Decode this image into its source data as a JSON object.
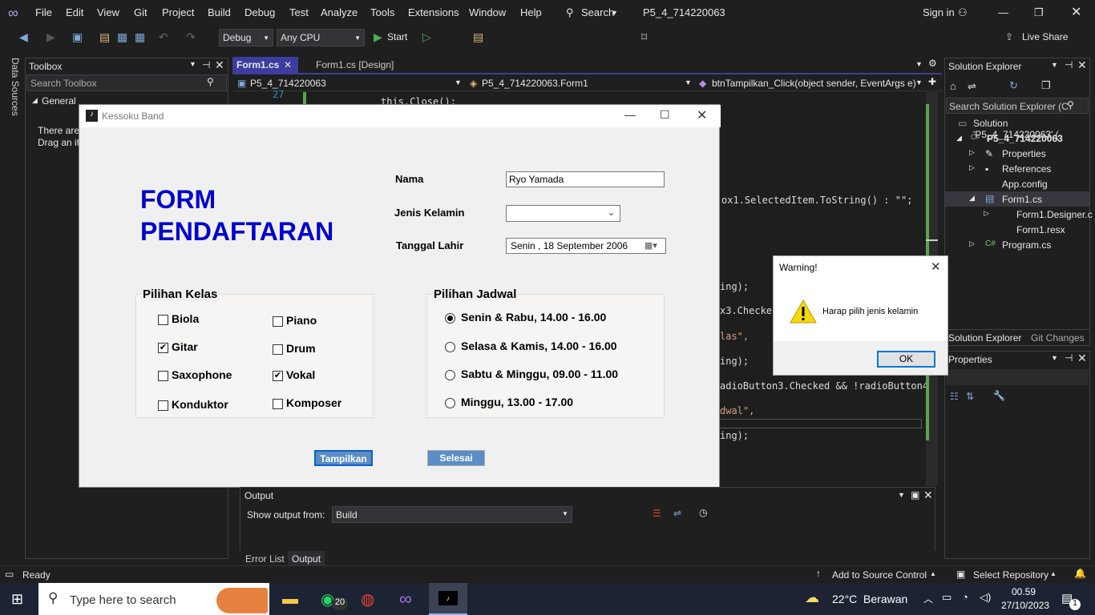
{
  "menubar": {
    "items": [
      "File",
      "Edit",
      "View",
      "Git",
      "Project",
      "Build",
      "Debug",
      "Test",
      "Analyze",
      "Tools",
      "Extensions",
      "Window",
      "Help"
    ],
    "search": "Search",
    "solution_name": "P5_4_714220063",
    "sign_in": "Sign in"
  },
  "toolbar": {
    "config": "Debug",
    "platform": "Any CPU",
    "start": "Start",
    "live_share": "Live Share"
  },
  "toolbox": {
    "title": "Toolbox",
    "search_placeholder": "Search Toolbox",
    "group": "General",
    "empty_text_1": "There are",
    "empty_text_2": "Drag an it"
  },
  "left_rail": {
    "data_sources": "Data Sources"
  },
  "tabs": {
    "tab1": "Form1.cs",
    "tab2": "Form1.cs [Design]"
  },
  "navbar": {
    "project": "P5_4_714220063",
    "class": "P5_4_714220063.Form1",
    "member": "btnTampilkan_Click(object sender, EventArgs e)"
  },
  "code": {
    "line_no": "27",
    "line_top": "this.Close();",
    "l1": "ox1.SelectedItem.ToString() : \"\";",
    "l2": "ing);",
    "l3": "x3.Checke",
    "l4": "las\",",
    "l5": "ing);",
    "l6": "adioButton3.Checked && !radioButton4.",
    "l7": "dwal\",",
    "l8": "ing);"
  },
  "form": {
    "window_title": "Kessoku Band",
    "heading_line1": "FORM",
    "heading_line2": "PENDAFTARAN",
    "label_nama": "Nama",
    "nama_value": "Ryo Yamada",
    "label_jk": "Jenis Kelamin",
    "jk_value": "",
    "label_tgl": "Tanggal Lahir",
    "tgl_value": "Senin , 18 September 2006",
    "group_kelas": "Pilihan Kelas",
    "kelas": [
      {
        "label": "Biola",
        "checked": false
      },
      {
        "label": "Piano",
        "checked": false
      },
      {
        "label": "Gitar",
        "checked": true
      },
      {
        "label": "Drum",
        "checked": false
      },
      {
        "label": "Saxophone",
        "checked": false
      },
      {
        "label": "Vokal",
        "checked": true
      },
      {
        "label": "Konduktor",
        "checked": false
      },
      {
        "label": "Komposer",
        "checked": false
      }
    ],
    "group_jadwal": "Pilihan Jadwal",
    "jadwal": [
      {
        "label": "Senin & Rabu, 14.00 - 16.00",
        "selected": true
      },
      {
        "label": "Selasa & Kamis, 14.00 - 16.00",
        "selected": false
      },
      {
        "label": "Sabtu & Minggu, 09.00 - 11.00",
        "selected": false
      },
      {
        "label": "Minggu, 13.00 - 17.00",
        "selected": false
      }
    ],
    "btn_show": "Tampilkan",
    "btn_done": "Selesai"
  },
  "warning": {
    "title": "Warning!",
    "message": "Harap pilih jenis kelamin",
    "ok": "OK"
  },
  "solution_explorer": {
    "title": "Solution Explorer",
    "search": "Search Solution Explorer (C",
    "solution": "Solution 'P5_4_714220063' (",
    "project": "P5_4_714220063",
    "properties": "Properties",
    "references": "References",
    "appconfig": "App.config",
    "form1cs": "Form1.cs",
    "designer": "Form1.Designer.c",
    "resx": "Form1.resx",
    "program": "Program.cs",
    "tab_se": "Solution Explorer",
    "tab_git": "Git Changes"
  },
  "properties": {
    "title": "Properties"
  },
  "output": {
    "title": "Output",
    "show_from": "Show output from:",
    "source": "Build",
    "tab_errors": "Error List",
    "tab_output": "Output"
  },
  "status": {
    "ready": "Ready",
    "add_source": "Add to Source Control",
    "select_repo": "Select Repository"
  },
  "taskbar": {
    "search_placeholder": "Type here to search",
    "whatsapp_badge": "20",
    "weather": "22°C  Berawan",
    "time": "00.59",
    "date": "27/10/2023",
    "notif": "1"
  },
  "colors": {
    "accent": "#0000cc",
    "vs_bg": "#1f1f1f",
    "button": "#5b8ec4"
  }
}
